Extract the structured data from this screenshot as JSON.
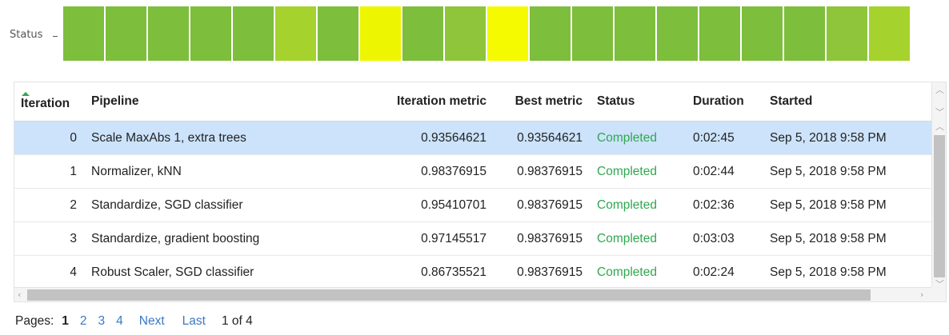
{
  "heatmap": {
    "label": "Status",
    "cells": [
      "#7dbe3c",
      "#7dbe3c",
      "#7dbe3c",
      "#7dbe3c",
      "#7dbe3c",
      "#a5d22c",
      "#7dbe3c",
      "#eef500",
      "#7dbe3c",
      "#8ec53a",
      "#f6fa00",
      "#7dbe3c",
      "#7dbe3c",
      "#7dbe3c",
      "#7dbe3c",
      "#7dbe3c",
      "#7dbe3c",
      "#7dbe3c",
      "#8ec53a",
      "#a5d22c"
    ]
  },
  "table": {
    "columns": {
      "iteration": "Iteration",
      "pipeline": "Pipeline",
      "iteration_metric": "Iteration metric",
      "best_metric": "Best metric",
      "status": "Status",
      "duration": "Duration",
      "started": "Started"
    },
    "sort": {
      "column": "iteration",
      "direction": "ascending"
    },
    "rows": [
      {
        "iteration": "0",
        "pipeline": "Scale MaxAbs 1, extra trees",
        "iteration_metric": "0.93564621",
        "best_metric": "0.93564621",
        "status": "Completed",
        "duration": "0:02:45",
        "started": "Sep 5, 2018 9:58 PM"
      },
      {
        "iteration": "1",
        "pipeline": "Normalizer, kNN",
        "iteration_metric": "0.98376915",
        "best_metric": "0.98376915",
        "status": "Completed",
        "duration": "0:02:44",
        "started": "Sep 5, 2018 9:58 PM"
      },
      {
        "iteration": "2",
        "pipeline": "Standardize, SGD classifier",
        "iteration_metric": "0.95410701",
        "best_metric": "0.98376915",
        "status": "Completed",
        "duration": "0:02:36",
        "started": "Sep 5, 2018 9:58 PM"
      },
      {
        "iteration": "3",
        "pipeline": "Standardize, gradient boosting",
        "iteration_metric": "0.97145517",
        "best_metric": "0.98376915",
        "status": "Completed",
        "duration": "0:03:03",
        "started": "Sep 5, 2018 9:58 PM"
      },
      {
        "iteration": "4",
        "pipeline": "Robust Scaler, SGD classifier",
        "iteration_metric": "0.86735521",
        "best_metric": "0.98376915",
        "status": "Completed",
        "duration": "0:02:24",
        "started": "Sep 5, 2018 9:58 PM"
      }
    ],
    "status_color": "#2fa84f",
    "selected_row_color": "#cce3fb"
  },
  "pager": {
    "label": "Pages:",
    "pages": [
      "1",
      "2",
      "3",
      "4"
    ],
    "current_page": "1",
    "next_label": "Next",
    "last_label": "Last",
    "count_text": "1 of 4"
  }
}
